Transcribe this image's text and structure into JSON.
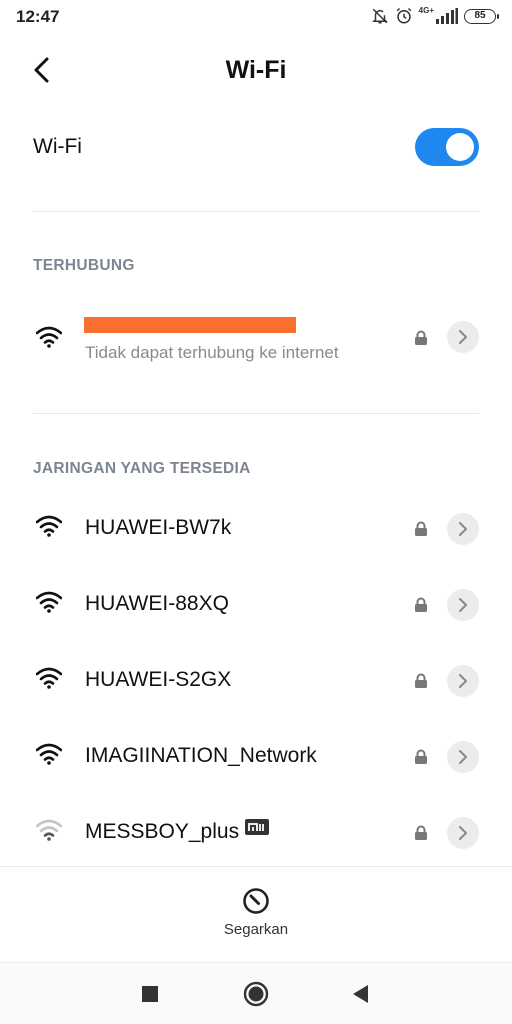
{
  "status_bar": {
    "time": "12:47",
    "network_label": "4G+",
    "battery": "85",
    "icons": [
      "notifications-off-icon",
      "alarm-icon",
      "signal-icon",
      "battery-icon"
    ]
  },
  "header": {
    "title": "Wi-Fi",
    "back_icon": "chevron-left-icon"
  },
  "wifi_toggle": {
    "label": "Wi-Fi",
    "state": "on",
    "accent_color": "#1e88f0"
  },
  "connected_section": {
    "header": "TERHUBUNG",
    "network": {
      "ssid": "",
      "ssid_redacted": true,
      "redaction_color": "#fa6f2d",
      "status": "Tidak dapat terhubung ke internet",
      "secured": true,
      "signal": "full"
    }
  },
  "available_section": {
    "header": "JARINGAN YANG TERSEDIA",
    "networks": [
      {
        "ssid": "HUAWEI-BW7k",
        "secured": true,
        "signal": "full"
      },
      {
        "ssid": "HUAWEI-88XQ",
        "secured": true,
        "signal": "full"
      },
      {
        "ssid": "HUAWEI-S2GX",
        "secured": true,
        "signal": "full"
      },
      {
        "ssid": "IMAGIINATION_Network",
        "secured": true,
        "signal": "full"
      },
      {
        "ssid": "MESSBOY_plus",
        "secured": true,
        "signal": "weak",
        "badge": "mi-icon"
      }
    ]
  },
  "bottom_action": {
    "label": "Segarkan",
    "icon": "refresh-icon"
  },
  "nav_bar": {
    "buttons": [
      "recents-square-icon",
      "home-circle-icon",
      "back-triangle-icon"
    ]
  }
}
